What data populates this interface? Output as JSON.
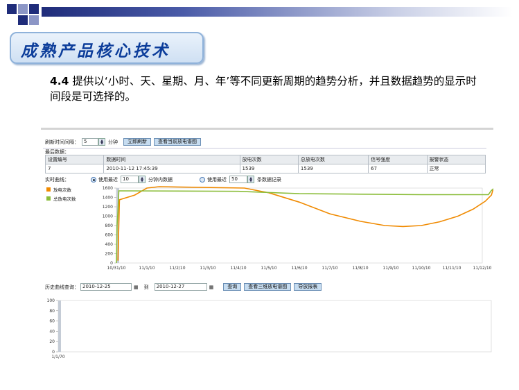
{
  "slide": {
    "title": "成熟产品核心技术",
    "bullet_number": "4.4",
    "bullet_text": " 提供以‘小时、天、星期、月、年’等不同更新周期的趋势分析，并且数据趋势的显示时间段是可选择的。"
  },
  "colors": {
    "title": "#0c3d9a",
    "series_fault": "#f08a00",
    "series_total": "#8bbd3a",
    "button": "#c6dcf0"
  },
  "app": {
    "refresh_label": "刷新时间间隔：",
    "refresh_value": "5",
    "refresh_unit": "分钟",
    "refresh_now_button": "立即刷新",
    "view_current_button": "查看当前放电谱图",
    "current_data_label": "最后数据：",
    "table": {
      "headers": [
        "设置编号",
        "数据时间",
        "放电次数",
        "总放电次数",
        "信号强度",
        "报警状态"
      ],
      "rows": [
        [
          "7",
          "2010-11-12 17:45:39",
          "1539",
          "1539",
          "67",
          "正常"
        ]
      ]
    },
    "realtime_label": "实时曲线：",
    "radio1_label": "使用最近",
    "radio1_value": "10",
    "radio1_unit": "分钟内数据",
    "radio2_label": "使用最近",
    "radio2_value": "50",
    "radio2_unit": "条数据记录",
    "legend": [
      "放电次数",
      "总放电次数"
    ],
    "history_label": "历史曲线查询：",
    "date_from": "2010-12-25",
    "date_to_label": "到",
    "date_to": "2010-12-27",
    "query_button": "查询",
    "view_3d_button": "查看三维放电谱图",
    "report_button": "导放报表"
  },
  "chart_data": [
    {
      "type": "line",
      "x": [
        "10/31/10",
        "11/1/10",
        "11/2/10",
        "11/3/10",
        "11/4/10",
        "11/5/10",
        "11/6/10",
        "11/7/10",
        "11/8/10",
        "11/9/10",
        "11/10/10",
        "11/11/10",
        "11/12/10"
      ],
      "ylim": [
        0,
        1600
      ],
      "yticks": [
        0,
        200,
        400,
        600,
        800,
        1000,
        1200,
        1400,
        1600
      ],
      "series": [
        {
          "name": "放电次数",
          "color": "#f08a00",
          "points": [
            [
              0.05,
              50
            ],
            [
              0.1,
              1350
            ],
            [
              0.6,
              1450
            ],
            [
              1.0,
              1600
            ],
            [
              1.4,
              1750
            ],
            [
              4.2,
              1600
            ],
            [
              5.0,
              1500
            ],
            [
              6.0,
              1300
            ],
            [
              7.0,
              1050
            ],
            [
              8.0,
              890
            ],
            [
              8.8,
              800
            ],
            [
              9.4,
              780
            ],
            [
              10.0,
              800
            ],
            [
              10.6,
              880
            ],
            [
              11.2,
              1000
            ],
            [
              11.7,
              1150
            ],
            [
              12.1,
              1320
            ],
            [
              12.3,
              1450
            ],
            [
              12.35,
              1560
            ],
            [
              12.4,
              1620
            ]
          ]
        },
        {
          "name": "总放电次数",
          "color": "#8bbd3a",
          "points": [
            [
              0.0,
              0
            ],
            [
              0.02,
              800
            ],
            [
              0.05,
              1100
            ],
            [
              0.08,
              1540
            ],
            [
              4.0,
              1530
            ],
            [
              6.0,
              1480
            ],
            [
              8.0,
              1470
            ],
            [
              10.0,
              1460
            ],
            [
              12.2,
              1460
            ],
            [
              12.3,
              1550
            ],
            [
              12.4,
              1600
            ]
          ]
        }
      ]
    },
    {
      "type": "line",
      "x": [
        "1/1/70"
      ],
      "ylim": [
        0,
        100
      ],
      "yticks": [
        0,
        20,
        40,
        60,
        80,
        100
      ],
      "series": []
    }
  ]
}
